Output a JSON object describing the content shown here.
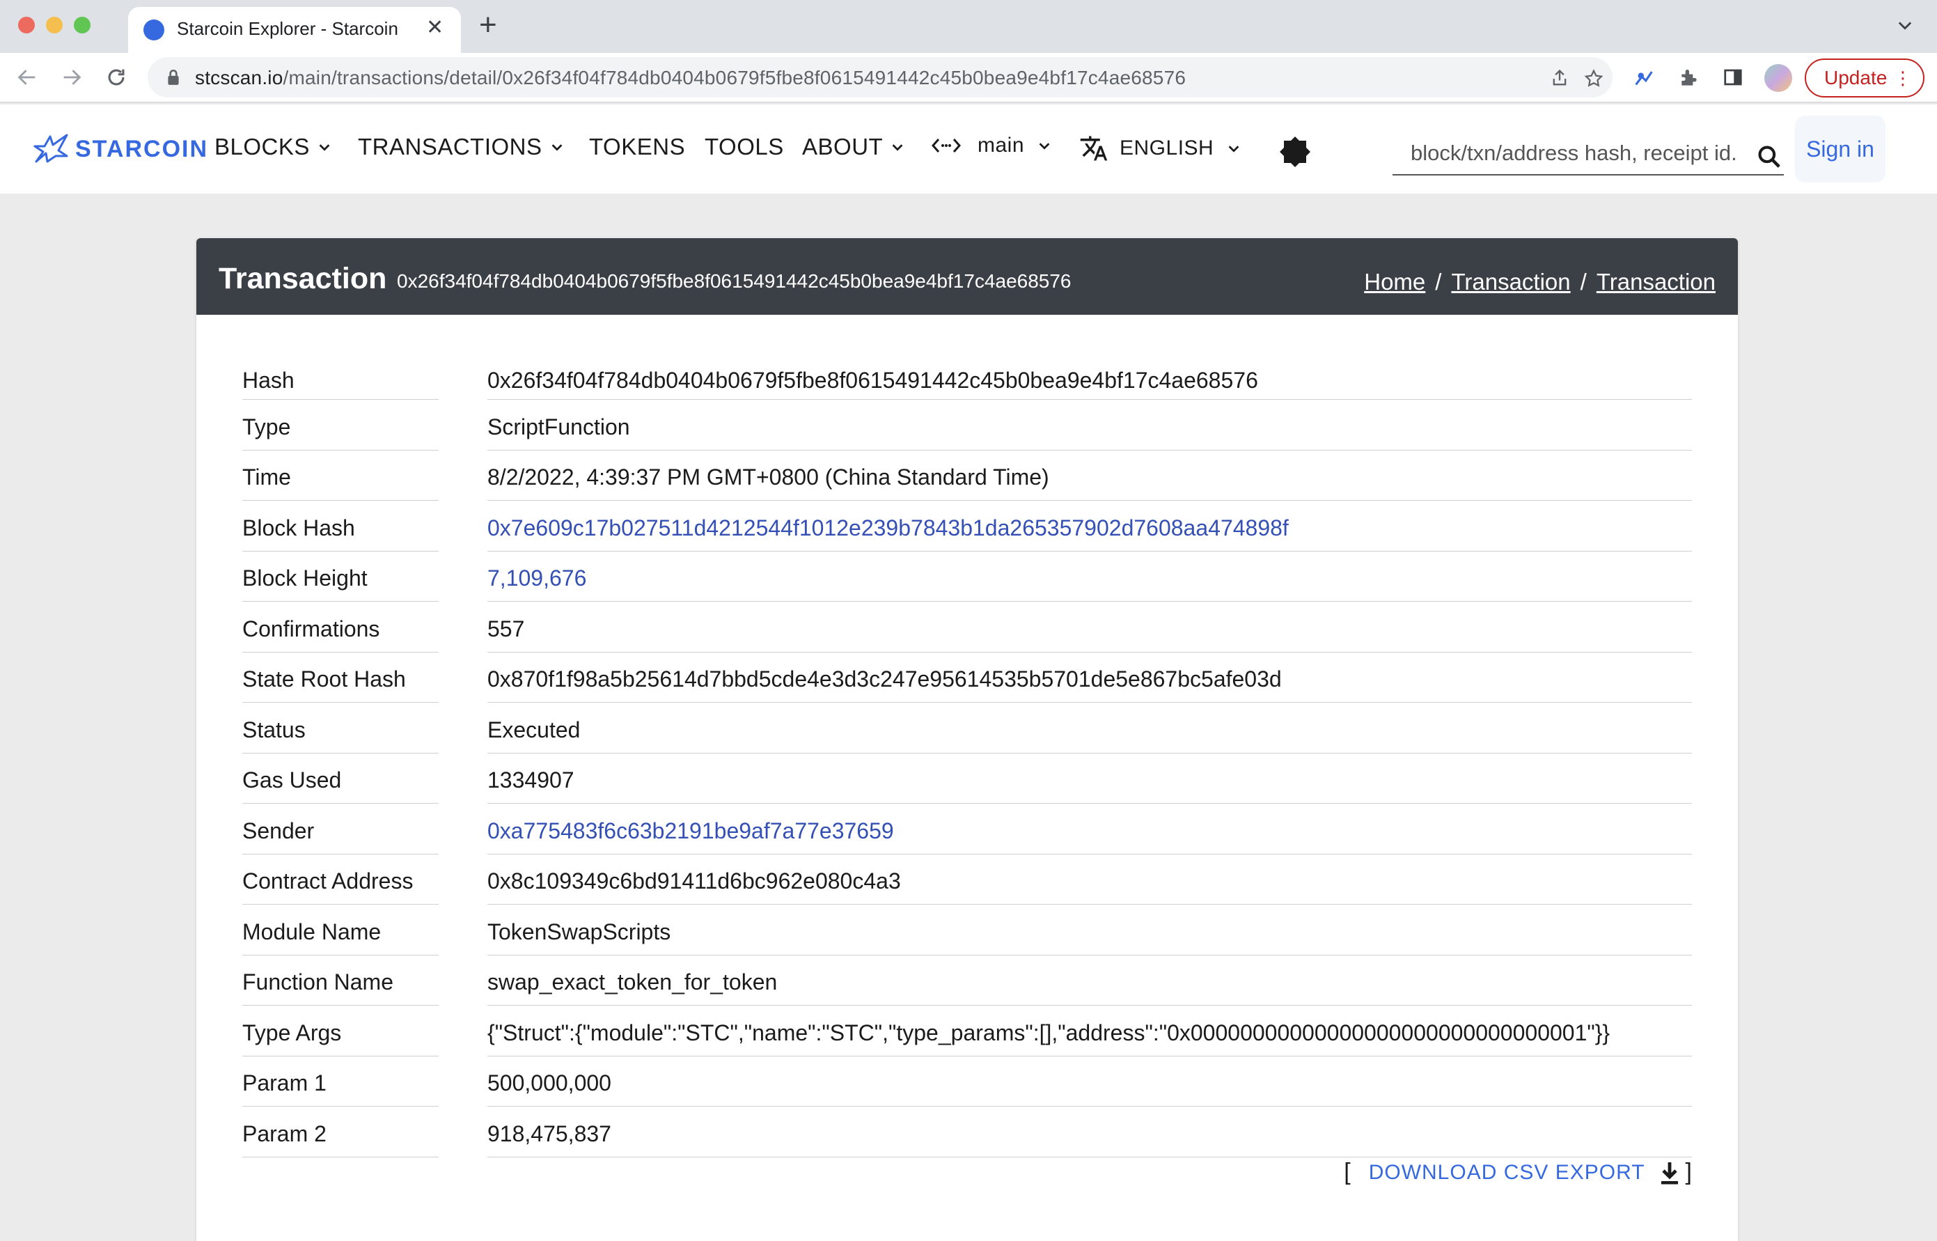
{
  "browser": {
    "tab_title": "Starcoin Explorer - Starcoin",
    "url_host": "stcscan.io",
    "url_path": "/main/transactions/detail/0x26f34f04f784db0404b0679f5fbe8f0615491442c45b0bea9e4bf17c4ae68576",
    "update_label": "Update"
  },
  "header": {
    "logo_text": "STARCOIN",
    "nav": {
      "blocks": "BLOCKS",
      "transactions": "TRANSACTIONS",
      "tokens": "TOKENS",
      "tools": "TOOLS",
      "about": "ABOUT",
      "network": "main",
      "language": "ENGLISH"
    },
    "search_placeholder": "block/txn/address hash, receipt id.",
    "signin_label": "Sign in"
  },
  "card": {
    "title": "Transaction",
    "hash": "0x26f34f04f784db0404b0679f5fbe8f0615491442c45b0bea9e4bf17c4ae68576",
    "breadcrumb": [
      "Home",
      "Transaction",
      "Transaction"
    ]
  },
  "details": [
    {
      "label": "Hash",
      "value": "0x26f34f04f784db0404b0679f5fbe8f0615491442c45b0bea9e4bf17c4ae68576",
      "link": false
    },
    {
      "label": "Type",
      "value": "ScriptFunction",
      "link": false
    },
    {
      "label": "Time",
      "value": "8/2/2022, 4:39:37 PM GMT+0800 (China Standard Time)",
      "link": false
    },
    {
      "label": "Block Hash",
      "value": "0x7e609c17b027511d4212544f1012e239b7843b1da265357902d7608aa474898f",
      "link": true
    },
    {
      "label": "Block Height",
      "value": "7,109,676",
      "link": true
    },
    {
      "label": "Confirmations",
      "value": "557",
      "link": false
    },
    {
      "label": "State Root Hash",
      "value": "0x870f1f98a5b25614d7bbd5cde4e3d3c247e95614535b5701de5e867bc5afe03d",
      "link": false
    },
    {
      "label": "Status",
      "value": "Executed",
      "link": false
    },
    {
      "label": "Gas Used",
      "value": "1334907",
      "link": false
    },
    {
      "label": "Sender",
      "value": "0xa775483f6c63b2191be9af7a77e37659",
      "link": true
    },
    {
      "label": "Contract Address",
      "value": "0x8c109349c6bd91411d6bc962e080c4a3",
      "link": false
    },
    {
      "label": "Module Name",
      "value": "TokenSwapScripts",
      "link": false
    },
    {
      "label": "Function Name",
      "value": "swap_exact_token_for_token",
      "link": false
    },
    {
      "label": "Type Args",
      "value": "{\"Struct\":{\"module\":\"STC\",\"name\":\"STC\",\"type_params\":[],\"address\":\"0x00000000000000000000000000000001\"}}",
      "link": false
    },
    {
      "label": "Param 1",
      "value": "500,000,000",
      "link": false
    },
    {
      "label": "Param 2",
      "value": "918,475,837",
      "link": false
    }
  ],
  "export": {
    "open_bracket": "[",
    "label": "DOWNLOAD CSV EXPORT",
    "close_bracket": "]"
  },
  "colors": {
    "accent": "#3669e0",
    "link": "#3450b4",
    "header_bar": "#3b4047",
    "page_bg": "#ebebeb"
  }
}
